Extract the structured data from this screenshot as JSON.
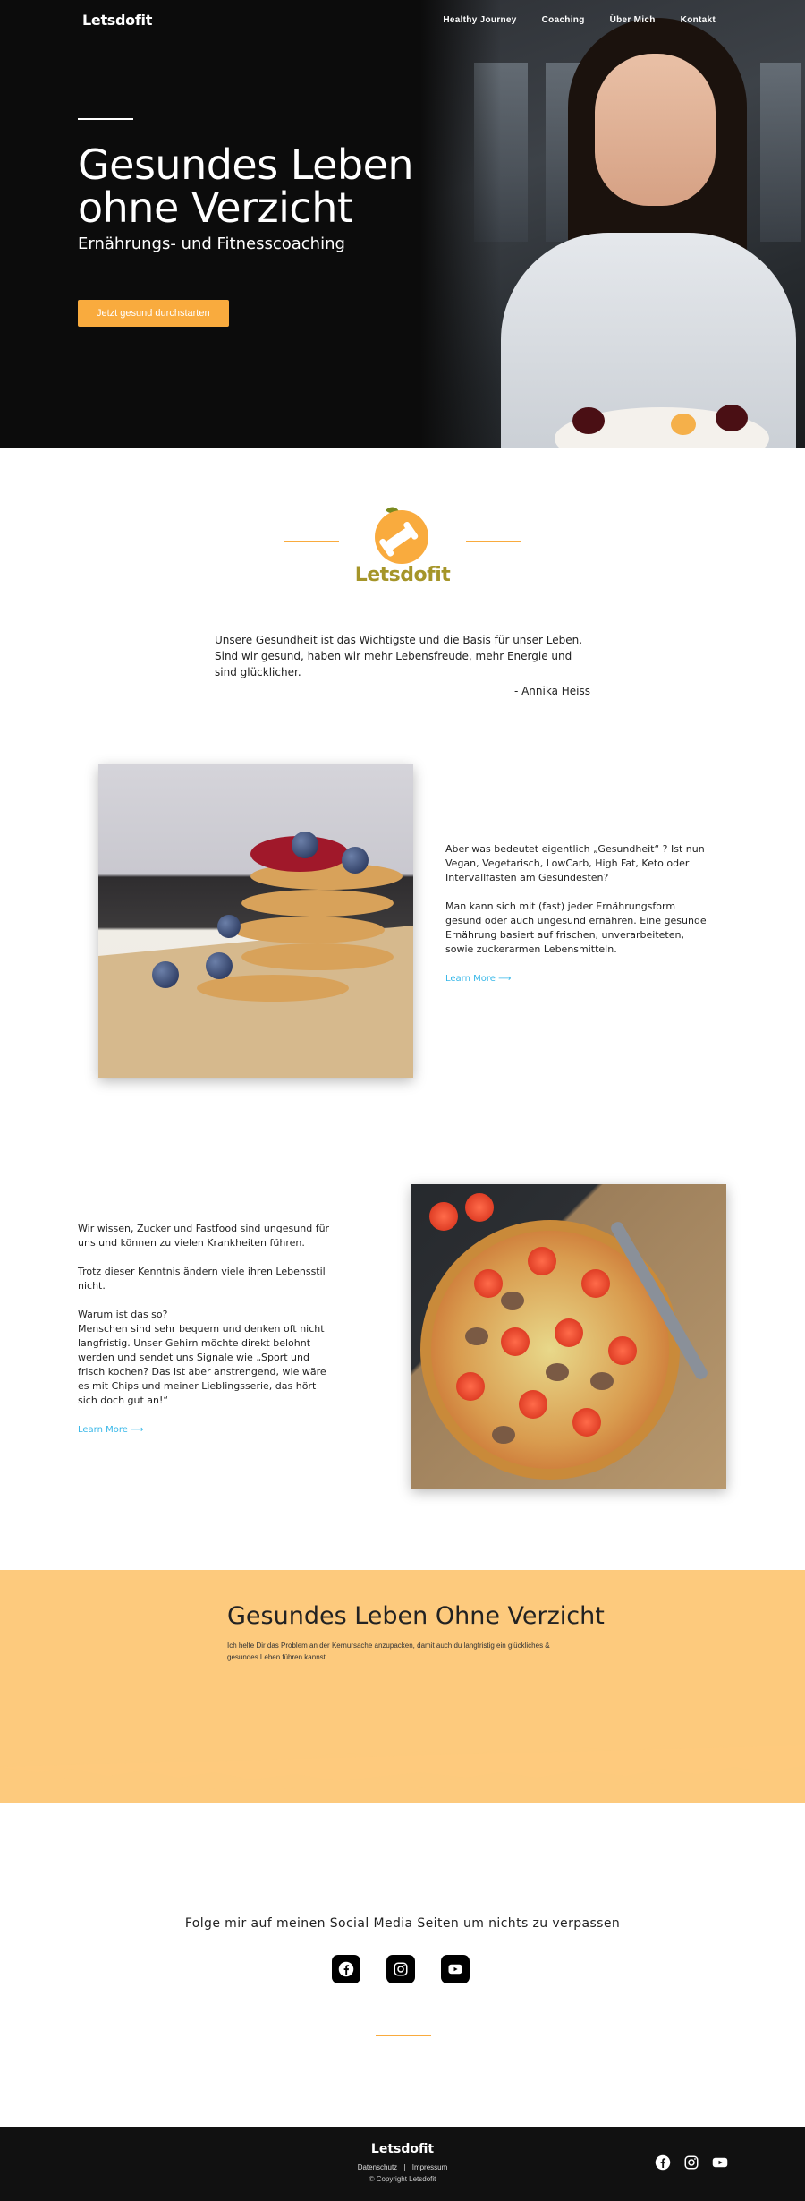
{
  "nav": {
    "logo": "Letsdofit",
    "links": [
      "Healthy Journey",
      "Coaching",
      "Über Mich",
      "Kontakt"
    ]
  },
  "hero": {
    "title_line1": "Gesundes Leben",
    "title_line2": "ohne Verzicht",
    "subtitle": "Ernährungs- und Fitnesscoaching",
    "cta": "Jetzt gesund durchstarten"
  },
  "brand": {
    "name": "Letsdofit"
  },
  "quote": {
    "text": "Unsere Gesundheit ist das Wichtigste und die Basis für unser Leben. Sind wir gesund, haben wir mehr Lebensfreude, mehr Energie und sind glücklicher.",
    "author": "- Annika Heiss"
  },
  "feature1": {
    "paragraphs": [
      "Aber was bedeutet eigentlich „Gesundheit“ ? Ist nun Vegan, Vegetarisch, LowCarb, High Fat, Keto oder Intervallfasten am Gesündesten?",
      "Man kann sich mit (fast) jeder Ernährungsform gesund oder auch ungesund ernähren. Eine gesunde Ernährung basiert auf frischen, unverarbeiteten, sowie zuckerarmen Lebensmitteln."
    ],
    "link": "Learn More ⟶"
  },
  "feature2": {
    "paragraphs": [
      "Wir wissen, Zucker und Fastfood sind ungesund für uns und können zu vielen Krankheiten führen.",
      "Trotz dieser Kenntnis ändern viele ihren Lebensstil nicht.",
      "Warum ist das so?\nMenschen sind sehr bequem und denken oft nicht langfristig. Unser Gehirn möchte direkt belohnt werden und sendet uns Signale wie „Sport und frisch kochen? Das ist aber anstrengend, wie wäre es mit Chips und meiner Lieblingsserie, das hört sich doch gut an!“"
    ],
    "link": "Learn More ⟶"
  },
  "band": {
    "title": "Gesundes Leben Ohne Verzicht",
    "text": "Ich helfe Dir das Problem an der Kernursache anzupacken, damit auch du langfristig ein glückliches & gesundes Leben führen kannst."
  },
  "social": {
    "title": "Folge mir auf meinen Social Media Seiten um nichts zu verpassen",
    "icons": [
      "facebook-icon",
      "instagram-icon",
      "youtube-icon"
    ]
  },
  "footer": {
    "logo": "Letsdofit",
    "link1": "Datenschutz",
    "separator": "|",
    "link2": "Impressum",
    "copyright": "© Copyright Letsdofit"
  },
  "colors": {
    "accent": "#f9ab3e",
    "band": "#fdca7d",
    "link": "#36b7e8",
    "brand_text": "#a59529"
  }
}
